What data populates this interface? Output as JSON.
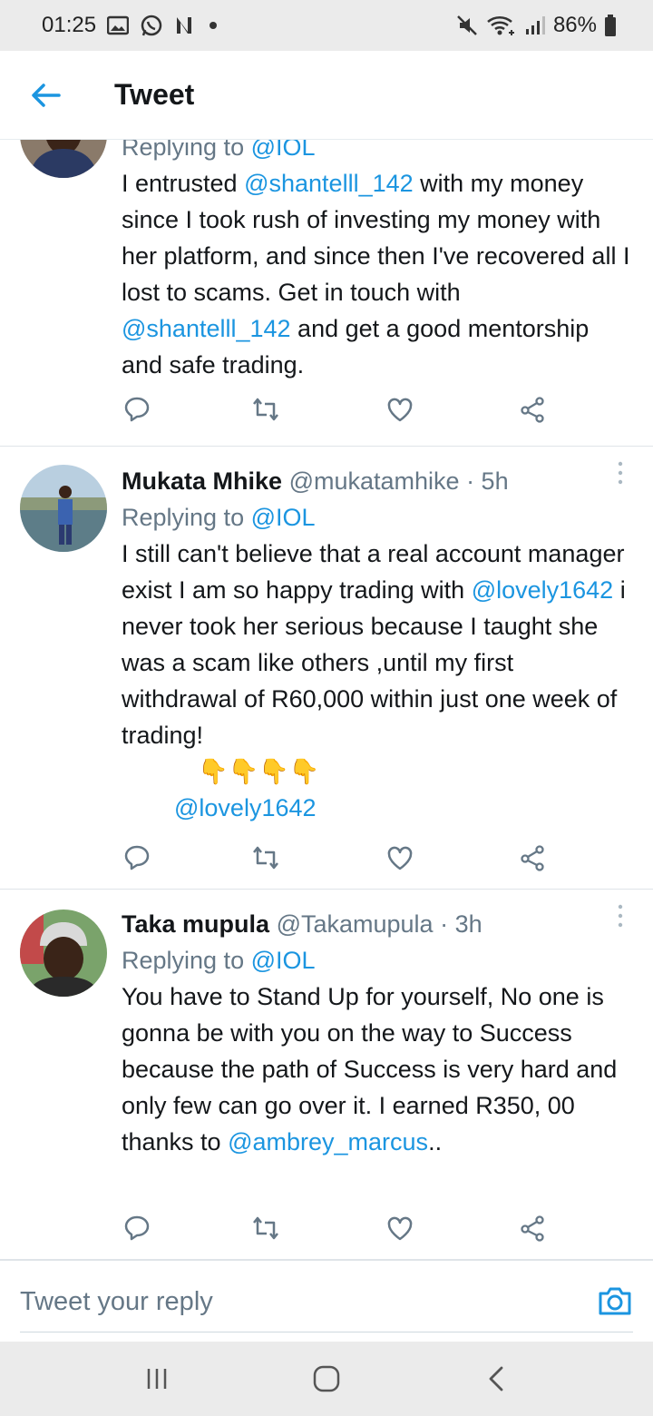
{
  "status_bar": {
    "time": "01:25",
    "battery": "86%",
    "icons_left": [
      "gallery-icon",
      "whatsapp-icon",
      "n-icon",
      "dot-icon"
    ],
    "icons_right": [
      "mute-icon",
      "wifi-icon",
      "signal-icon",
      "battery-icon"
    ]
  },
  "header": {
    "title": "Tweet",
    "back_icon": "back-arrow-icon"
  },
  "tweets": [
    {
      "reply_prefix": "Replying to ",
      "reply_to": "@IOL",
      "text": {
        "p1": "I entrusted ",
        "m1": "@shantelll_142",
        "p2": " with my money since I took rush of investing my money with her platform, and since then I've recovered all I lost to scams. Get in touch with ",
        "m2": "@shantelll_142",
        "p3": " and get a good mentorship and safe trading."
      }
    },
    {
      "name": "Mukata Mhike",
      "handle": "@mukatamhike",
      "time": "· 5h",
      "reply_prefix": "Replying to ",
      "reply_to": "@IOL",
      "text": {
        "p1": "I still can't believe that a real account manager exist I am so happy trading with ",
        "m1": "@lovely1642",
        "p2": " i never took her serious because I taught she was a scam like others ,until my first withdrawal of R60,000 within just one week of trading!",
        "emoji": "👇👇👇👇",
        "m2": "@lovely1642"
      }
    },
    {
      "name": "Taka mupula",
      "handle": "@Takamupula",
      "time": "· 3h",
      "reply_prefix": "Replying to ",
      "reply_to": "@IOL",
      "text": {
        "p1": "You have to Stand Up for yourself, No one is gonna be with you on the way to Success because the path of Success is very hard and only few can go over it. I earned R350, 00 thanks to ",
        "m1": "@ambrey_marcus",
        "p2": ".."
      }
    }
  ],
  "actions": [
    "reply-icon",
    "retweet-icon",
    "like-icon",
    "share-icon"
  ],
  "reply_bar": {
    "placeholder": "Tweet your reply"
  },
  "colors": {
    "accent": "#1b95e0",
    "text": "#14171a",
    "secondary": "#657786"
  }
}
